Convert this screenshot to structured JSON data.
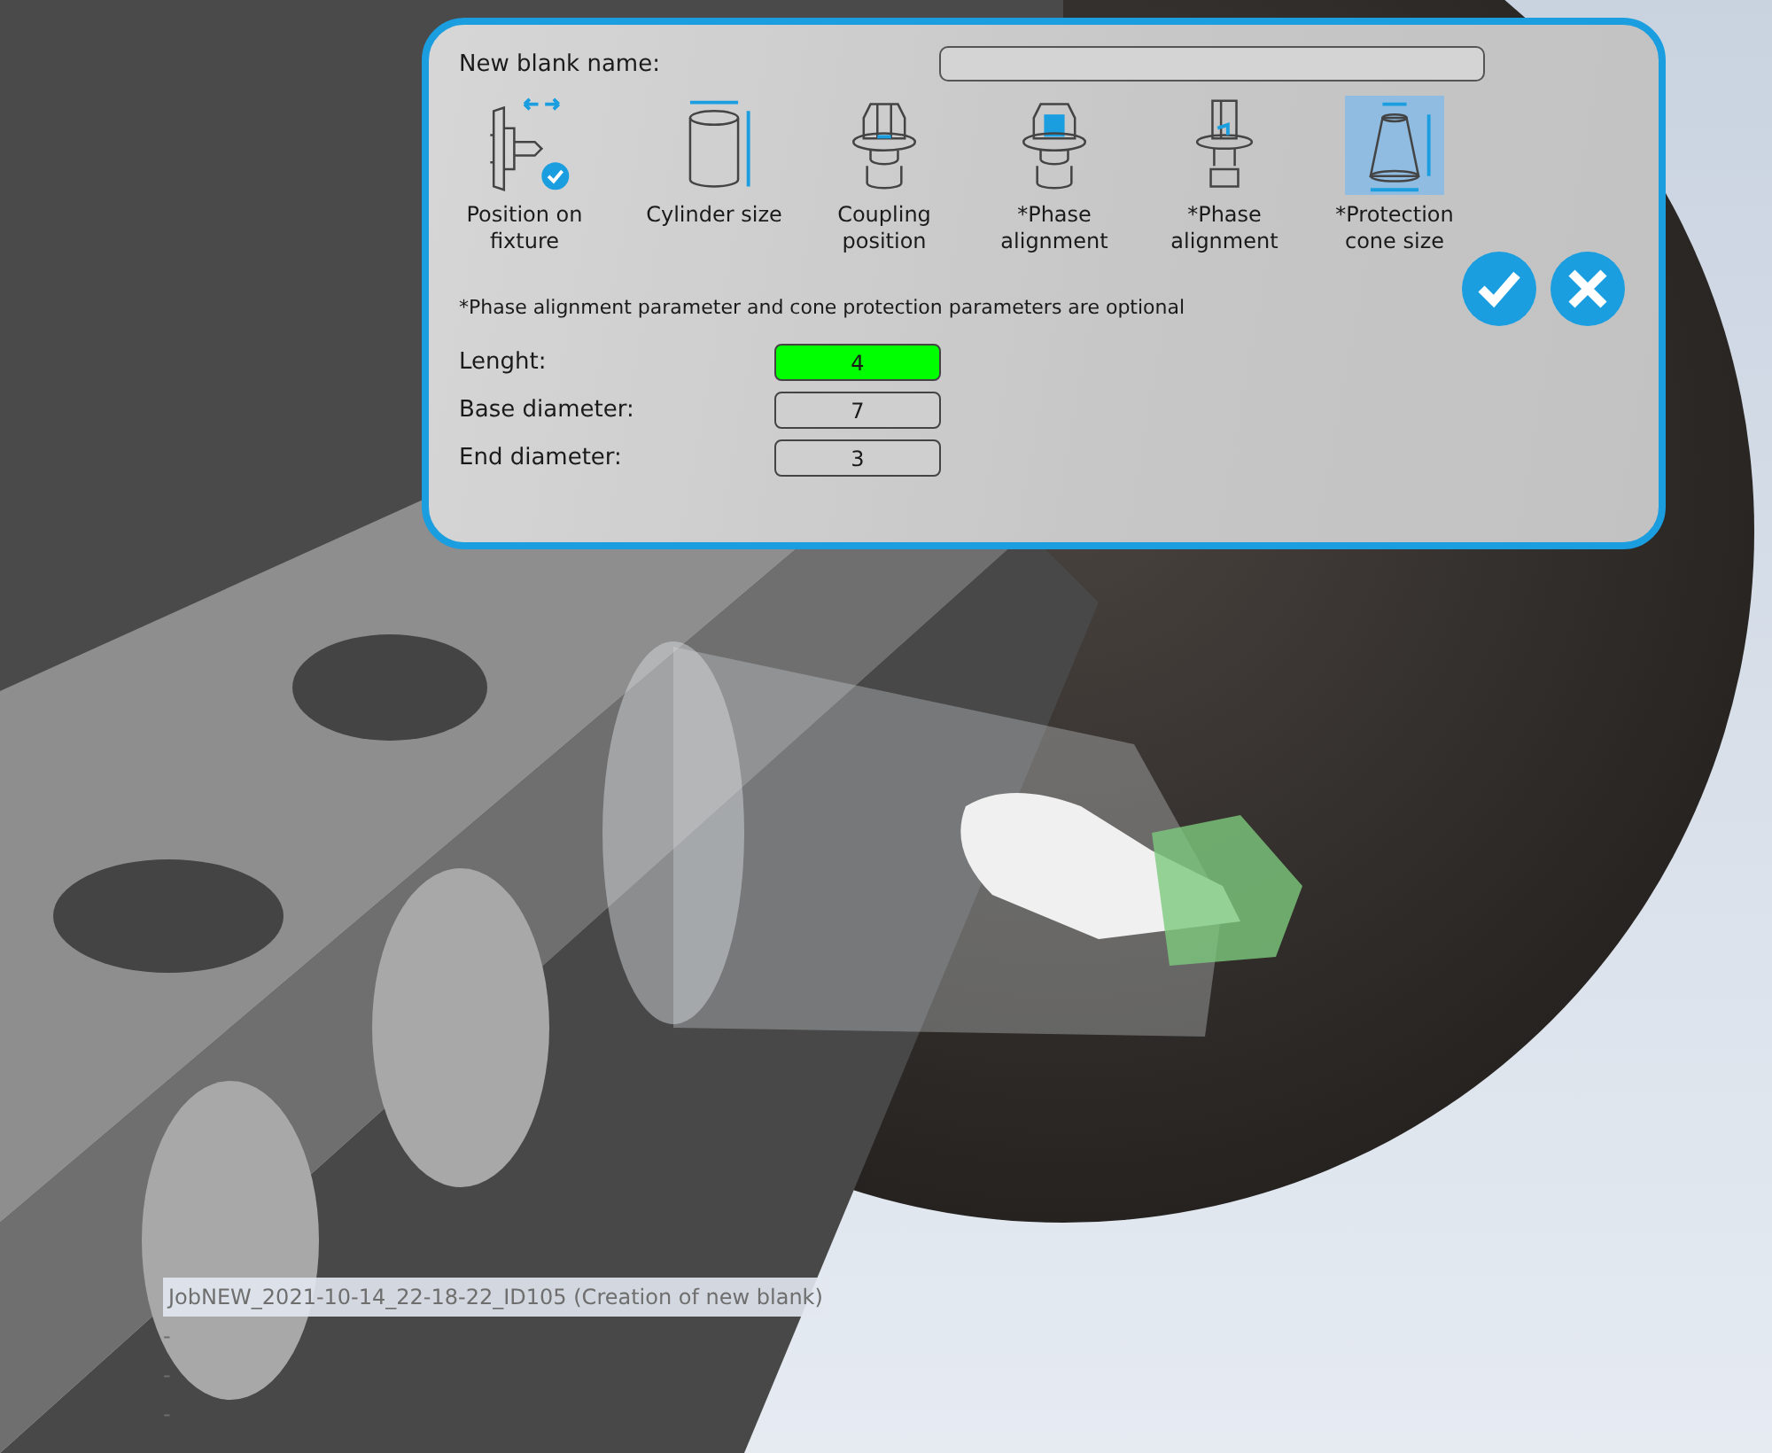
{
  "dialog": {
    "name_label": "New blank name:",
    "steps": [
      {
        "kind": "fixture",
        "label": "Position on fixture",
        "selected": false,
        "done": true
      },
      {
        "kind": "cylinder",
        "label": "Cylinder size",
        "selected": false,
        "done": false
      },
      {
        "kind": "coupling",
        "label": "Coupling position",
        "selected": false,
        "done": false
      },
      {
        "kind": "phase-hex",
        "label": "*Phase alignment",
        "selected": false,
        "done": false
      },
      {
        "kind": "phase-flat",
        "label": "*Phase alignment",
        "selected": false,
        "done": false
      },
      {
        "kind": "cone",
        "label": "*Protection cone size",
        "selected": true,
        "done": false
      }
    ],
    "footnote": "*Phase alignment parameter and cone protection parameters are optional",
    "parameters": [
      {
        "label": "Lenght:",
        "value": "4",
        "active": true
      },
      {
        "label": "Base diameter:",
        "value": "7",
        "active": false
      },
      {
        "label": "End diameter:",
        "value": "3",
        "active": false
      }
    ]
  },
  "status": {
    "title": "JobNEW_2021-10-14_22-18-22_ID105 (Creation of new blank)",
    "lines": [
      "-",
      "-",
      "-"
    ]
  }
}
